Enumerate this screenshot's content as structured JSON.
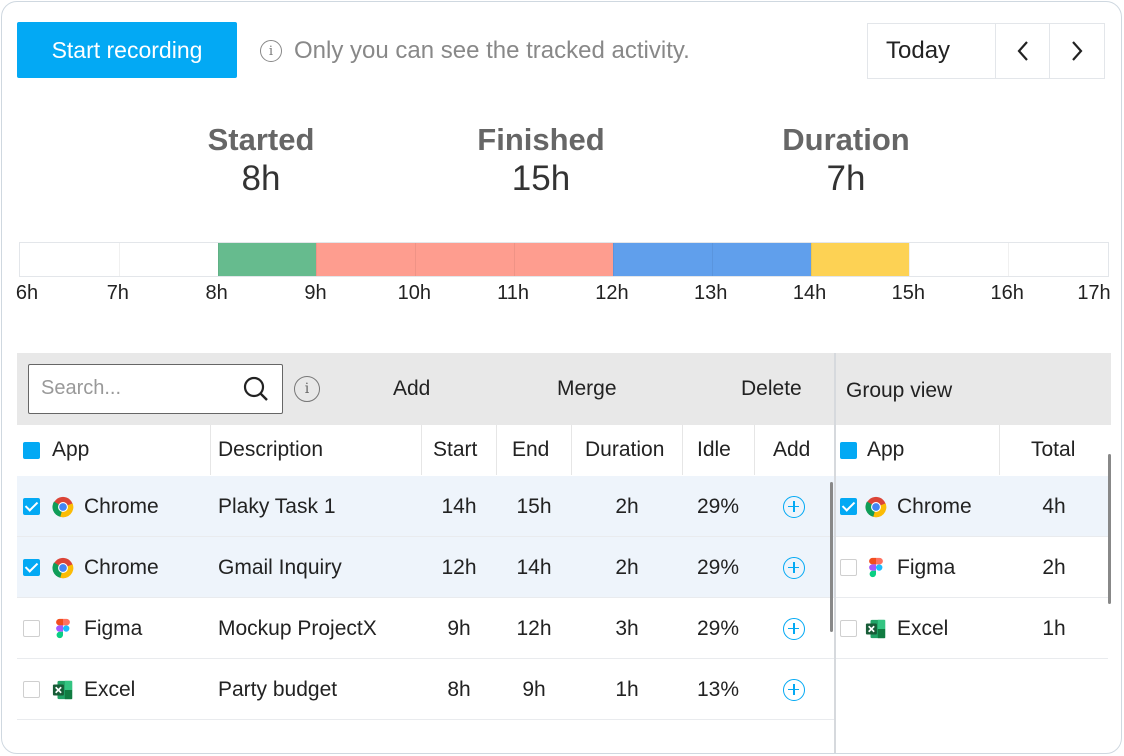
{
  "header": {
    "start_button": "Start recording",
    "info_text": "Only you can see the tracked activity.",
    "date_label": "Today"
  },
  "stats": {
    "started_label": "Started",
    "started_value": "8h",
    "finished_label": "Finished",
    "finished_value": "15h",
    "duration_label": "Duration",
    "duration_value": "7h"
  },
  "timeline": {
    "ticks": [
      "6h",
      "7h",
      "8h",
      "9h",
      "10h",
      "11h",
      "12h",
      "13h",
      "14h",
      "15h",
      "16h",
      "17h"
    ],
    "segments": [
      {
        "start": 8,
        "end": 9,
        "color": "#66bb8e"
      },
      {
        "start": 9,
        "end": 12,
        "color": "#fe9d8f"
      },
      {
        "start": 12,
        "end": 14,
        "color": "#609fec"
      },
      {
        "start": 14,
        "end": 15,
        "color": "#fdd254"
      }
    ]
  },
  "toolbar": {
    "search_placeholder": "Search...",
    "add": "Add",
    "merge": "Merge",
    "delete": "Delete",
    "group_view": "Group view"
  },
  "table": {
    "headers": {
      "app": "App",
      "description": "Description",
      "start": "Start",
      "end": "End",
      "duration": "Duration",
      "idle": "Idle",
      "add": "Add"
    },
    "rows": [
      {
        "app": "Chrome",
        "icon": "chrome-icon",
        "description": "Plaky Task 1",
        "start": "14h",
        "end": "15h",
        "duration": "2h",
        "idle": "29%",
        "checked": true
      },
      {
        "app": "Chrome",
        "icon": "chrome-icon",
        "description": "Gmail Inquiry",
        "start": "12h",
        "end": "14h",
        "duration": "2h",
        "idle": "29%",
        "checked": true
      },
      {
        "app": "Figma",
        "icon": "figma-icon",
        "description": "Mockup ProjectX",
        "start": "9h",
        "end": "12h",
        "duration": "3h",
        "idle": "29%",
        "checked": false
      },
      {
        "app": "Excel",
        "icon": "excel-icon",
        "description": "Party budget",
        "start": "8h",
        "end": "9h",
        "duration": "1h",
        "idle": "13%",
        "checked": false
      }
    ]
  },
  "group": {
    "headers": {
      "app": "App",
      "total": "Total"
    },
    "rows": [
      {
        "app": "Chrome",
        "icon": "chrome-icon",
        "total": "4h",
        "checked": true
      },
      {
        "app": "Figma",
        "icon": "figma-icon",
        "total": "2h",
        "checked": false
      },
      {
        "app": "Excel",
        "icon": "excel-icon",
        "total": "1h",
        "checked": false
      }
    ]
  },
  "colors": {
    "accent": "#03a9f4",
    "selected_row": "#eef4fb"
  }
}
